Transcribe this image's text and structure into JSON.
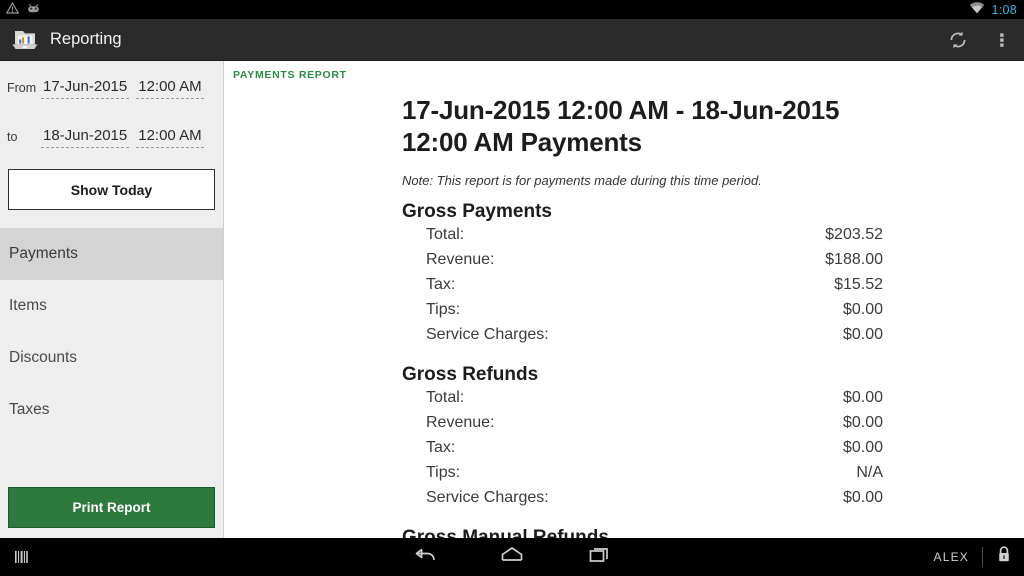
{
  "statusbar": {
    "time": "1:08",
    "time_color": "#33b5e5",
    "icons": [
      "warning-triangle-icon",
      "android-bug-icon",
      "wifi-icon"
    ]
  },
  "appbar": {
    "title": "Reporting",
    "logo_icon": "reporting-chart-logo-icon",
    "actions": [
      {
        "name": "refresh-icon",
        "label": "Refresh"
      },
      {
        "name": "overflow-menu-icon",
        "label": "More options"
      }
    ],
    "background": "#2b2b2b"
  },
  "sidebar": {
    "from": {
      "label": "From",
      "date": "17-Jun-2015",
      "time": "12:00 AM"
    },
    "to": {
      "label": "to",
      "date": "18-Jun-2015",
      "time": "12:00 AM"
    },
    "show_today_label": "Show Today",
    "nav_items": [
      {
        "label": "Payments",
        "selected": true
      },
      {
        "label": "Items",
        "selected": false
      },
      {
        "label": "Discounts",
        "selected": false
      },
      {
        "label": "Taxes",
        "selected": false
      }
    ],
    "print_report_label": "Print Report",
    "print_report_color": "#2e7a3d",
    "background": "#eeeeee",
    "selected_background": "#d4d4d4"
  },
  "report": {
    "kicker": "PAYMENTS REPORT",
    "kicker_color": "#2e8b46",
    "title": "17-Jun-2015 12:00 AM - 18-Jun-2015 12:00 AM Payments",
    "note": "Note: This report is for payments made during this time period.",
    "sections": [
      {
        "heading": "Gross Payments",
        "rows": [
          {
            "label": "Total:",
            "value": "$203.52"
          },
          {
            "label": "Revenue:",
            "value": "$188.00"
          },
          {
            "label": "Tax:",
            "value": "$15.52"
          },
          {
            "label": "Tips:",
            "value": "$0.00"
          },
          {
            "label": "Service Charges:",
            "value": "$0.00"
          }
        ]
      },
      {
        "heading": "Gross Refunds",
        "rows": [
          {
            "label": "Total:",
            "value": "$0.00"
          },
          {
            "label": "Revenue:",
            "value": "$0.00"
          },
          {
            "label": "Tax:",
            "value": "$0.00"
          },
          {
            "label": "Tips:",
            "value": "N/A"
          },
          {
            "label": "Service Charges:",
            "value": "$0.00"
          }
        ]
      },
      {
        "heading": "Gross Manual Refunds",
        "rows": []
      }
    ]
  },
  "navbar": {
    "left_icon": "barcode-scanner-icon",
    "buttons": [
      {
        "name": "back-icon",
        "label": "Back"
      },
      {
        "name": "home-icon",
        "label": "Home"
      },
      {
        "name": "recents-icon",
        "label": "Recent apps"
      }
    ],
    "user": "ALEX",
    "lock_icon": "lock-icon"
  }
}
